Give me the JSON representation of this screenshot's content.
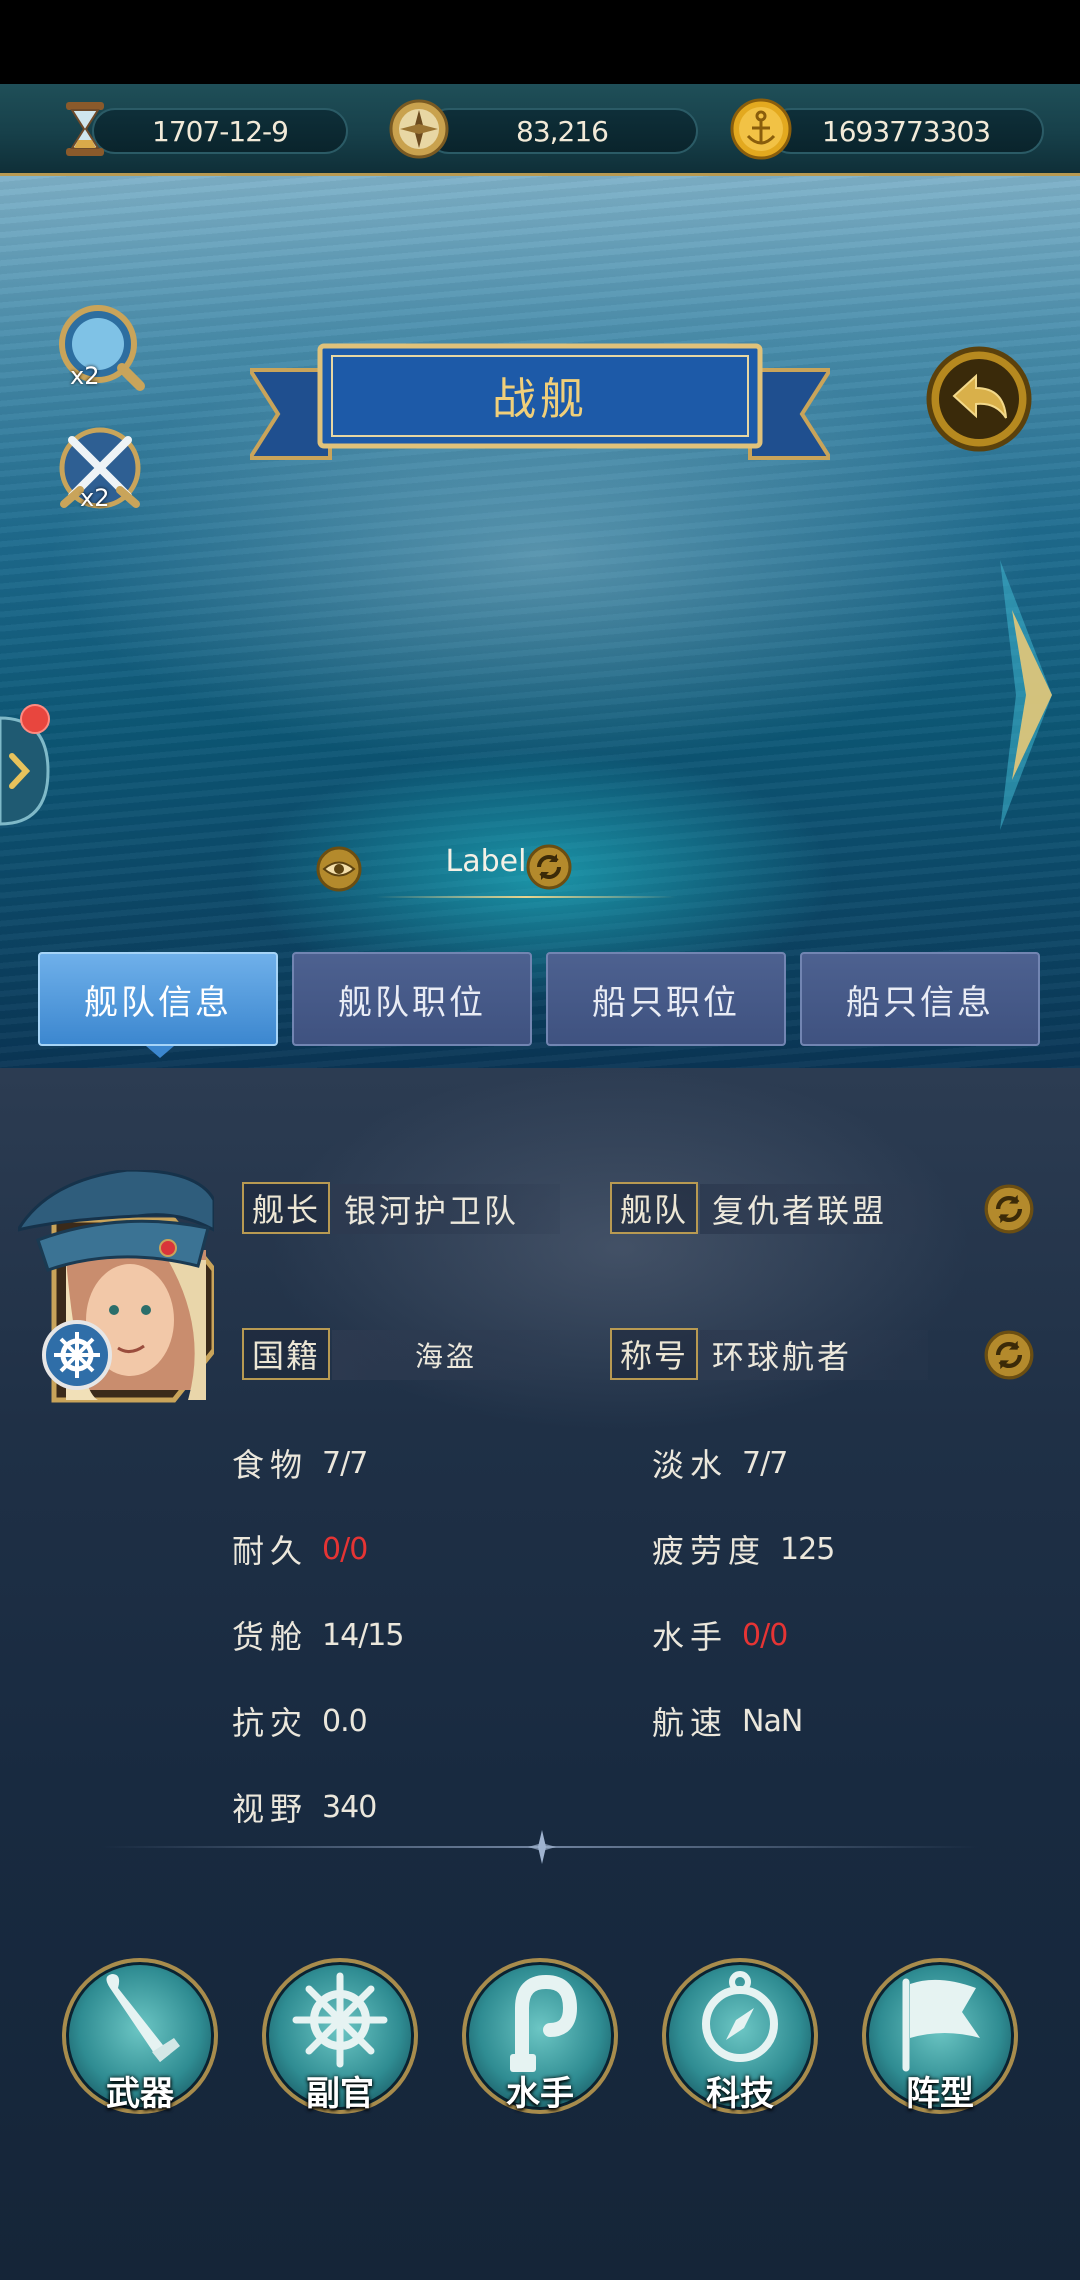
{
  "resources": {
    "date": "1707-12-9",
    "compass_value": "83,216",
    "gold": "1693773303"
  },
  "scene": {
    "buff_explore": "x2",
    "buff_battle": "x2",
    "banner_title": "战舰",
    "ship_label": "Label"
  },
  "tabs": [
    {
      "label": "舰队信息",
      "active": true
    },
    {
      "label": "舰队职位",
      "active": false
    },
    {
      "label": "船只职位",
      "active": false
    },
    {
      "label": "船只信息",
      "active": false
    }
  ],
  "info": {
    "captain_tag": "舰长",
    "captain_value": "银河护卫队",
    "fleet_tag": "舰队",
    "fleet_value": "复仇者联盟",
    "nationality_tag": "国籍",
    "nationality_value": "海盗",
    "title_tag": "称号",
    "title_value": "环球航者"
  },
  "stats": [
    {
      "label": "食物",
      "value": "7/7",
      "warn": false
    },
    {
      "label": "淡水",
      "value": "7/7",
      "warn": false
    },
    {
      "label": "耐久",
      "value": "0/0",
      "warn": true
    },
    {
      "label": "疲劳度",
      "value": "125",
      "warn": false
    },
    {
      "label": "货舱",
      "value": "14/15",
      "warn": false
    },
    {
      "label": "水手",
      "value": "0/0",
      "warn": true
    },
    {
      "label": "抗灾",
      "value": "0.0",
      "warn": false
    },
    {
      "label": "航速",
      "value": "NaN",
      "warn": false
    },
    {
      "label": "视野",
      "value": "340",
      "warn": false
    }
  ],
  "bottom_buttons": [
    {
      "label": "武器",
      "icon": "sword-icon"
    },
    {
      "label": "副官",
      "icon": "ship-wheel-icon"
    },
    {
      "label": "水手",
      "icon": "hook-icon"
    },
    {
      "label": "科技",
      "icon": "compass-icon"
    },
    {
      "label": "阵型",
      "icon": "flag-icon"
    }
  ],
  "colors": {
    "accent_gold": "#b89a52",
    "tab_active": "#3c87cf",
    "tab_inactive": "#4d6190",
    "warning_red": "#e53434"
  }
}
